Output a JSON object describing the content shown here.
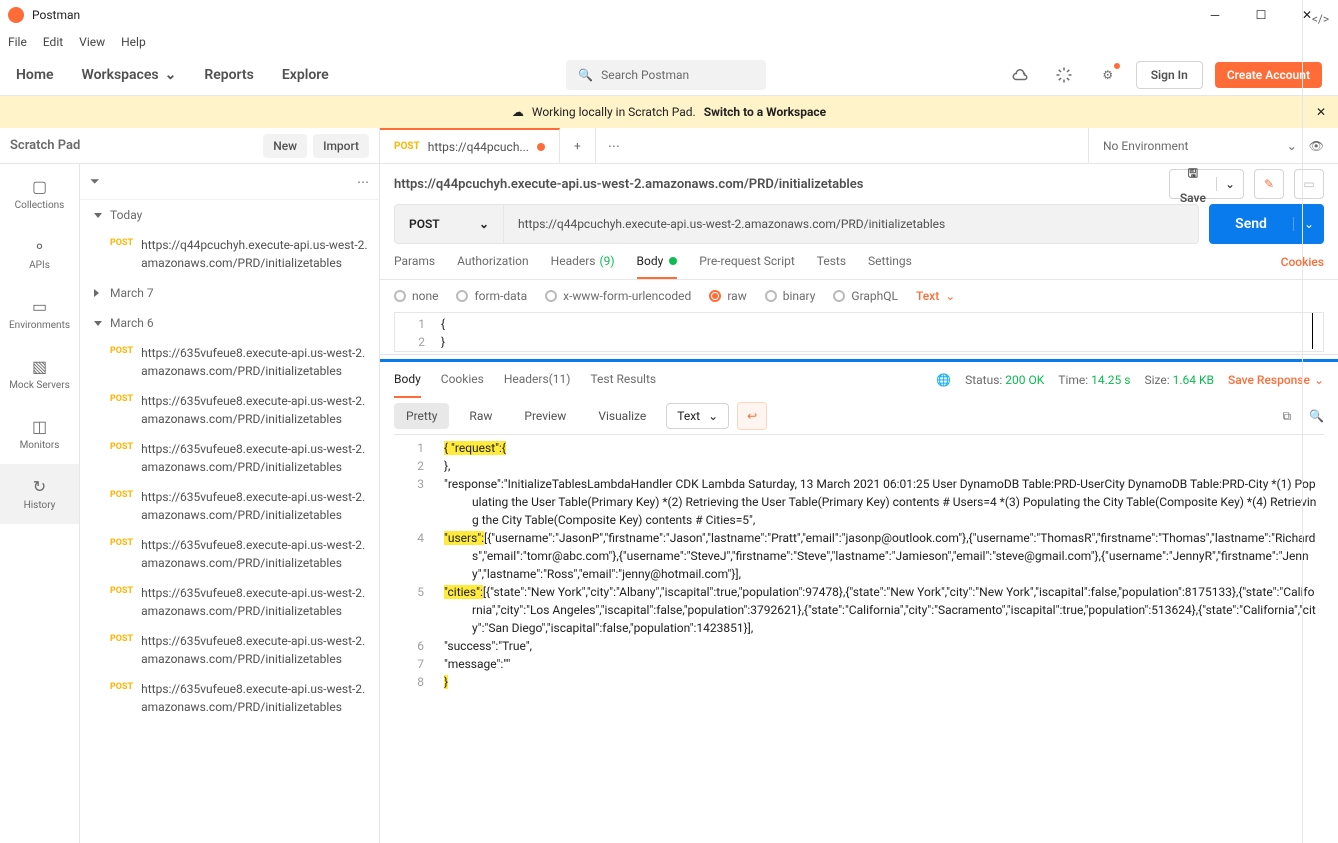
{
  "app": {
    "title": "Postman"
  },
  "menubar": [
    "File",
    "Edit",
    "View",
    "Help"
  ],
  "header": {
    "nav": [
      "Home",
      "Workspaces",
      "Reports",
      "Explore"
    ],
    "search_placeholder": "Search Postman",
    "signin": "Sign In",
    "create": "Create Account"
  },
  "banner": {
    "text": "Working locally in Scratch Pad.",
    "link": "Switch to a Workspace"
  },
  "sidebar": {
    "title": "Scratch Pad",
    "new": "New",
    "import": "Import",
    "iconbar": [
      {
        "label": "Collections"
      },
      {
        "label": "APIs"
      },
      {
        "label": "Environments"
      },
      {
        "label": "Mock Servers"
      },
      {
        "label": "Monitors"
      },
      {
        "label": "History"
      }
    ],
    "history": {
      "groups": [
        {
          "name": "Today",
          "items": [
            {
              "method": "POST",
              "url": "https://q44pcuchyh.execute-api.us-west-2.amazonaws.com/PRD/initializetables"
            }
          ]
        },
        {
          "name": "March 7",
          "collapsed": true,
          "items": []
        },
        {
          "name": "March 6",
          "items": [
            {
              "method": "POST",
              "url": "https://635vufeue8.execute-api.us-west-2.amazonaws.com/PRD/initializetables"
            },
            {
              "method": "POST",
              "url": "https://635vufeue8.execute-api.us-west-2.amazonaws.com/PRD/initializetables"
            },
            {
              "method": "POST",
              "url": "https://635vufeue8.execute-api.us-west-2.amazonaws.com/PRD/initializetables"
            },
            {
              "method": "POST",
              "url": "https://635vufeue8.execute-api.us-west-2.amazonaws.com/PRD/initializetables"
            },
            {
              "method": "POST",
              "url": "https://635vufeue8.execute-api.us-west-2.amazonaws.com/PRD/initializetables"
            },
            {
              "method": "POST",
              "url": "https://635vufeue8.execute-api.us-west-2.amazonaws.com/PRD/initializetables"
            },
            {
              "method": "POST",
              "url": "https://635vufeue8.execute-api.us-west-2.amazonaws.com/PRD/initializetables"
            },
            {
              "method": "POST",
              "url": "https://635vufeue8.execute-api.us-west-2.amazonaws.com/PRD/initializetables"
            }
          ]
        }
      ]
    }
  },
  "tab": {
    "method": "POST",
    "label": "https://q44pcuch..."
  },
  "env": "No Environment",
  "request": {
    "title": "https://q44pcuchyh.execute-api.us-west-2.amazonaws.com/PRD/initializetables",
    "save": "Save",
    "method": "POST",
    "url": "https://q44pcuchyh.execute-api.us-west-2.amazonaws.com/PRD/initializetables",
    "send": "Send",
    "tabs": {
      "params": "Params",
      "auth": "Authorization",
      "headers": "Headers",
      "headers_count": "(9)",
      "body": "Body",
      "prereq": "Pre-request Script",
      "tests": "Tests",
      "settings": "Settings",
      "cookies": "Cookies"
    },
    "bodytypes": [
      "none",
      "form-data",
      "x-www-form-urlencoded",
      "raw",
      "binary",
      "GraphQL"
    ],
    "raw_type": "Text",
    "body_lines": [
      "{",
      "}"
    ]
  },
  "response": {
    "tabs": {
      "body": "Body",
      "cookies": "Cookies",
      "headers": "Headers",
      "headers_count": "(11)",
      "tests": "Test Results"
    },
    "status_label": "Status:",
    "status_value": "200 OK",
    "time_label": "Time:",
    "time_value": "14.25 s",
    "size_label": "Size:",
    "size_value": "1.64 KB",
    "save": "Save Response",
    "view_opts": [
      "Pretty",
      "Raw",
      "Preview",
      "Visualize"
    ],
    "view_type": "Text",
    "lines": [
      {
        "n": 1,
        "segments": [
          {
            "t": "{ \"request\":{",
            "hl": true
          }
        ]
      },
      {
        "n": 2,
        "segments": [
          {
            "t": "},"
          }
        ]
      },
      {
        "n": 3,
        "segments": [
          {
            "t": "\"response\":\"InitializeTablesLambdaHandler CDK Lambda Saturday, 13 March 2021 06:01:25 User DynamoDB Table:PRD-UserCity DynamoDB Table:PRD-City *(1) Populating the User Table(Primary Key) *(2) Retrieving the User Table(Primary Key) contents # Users=4 *(3) Populating the City Table(Composite Key) *(4) Retrieving the City Table(Composite Key) contents # Cities=5\","
          }
        ]
      },
      {
        "n": 4,
        "segments": [
          {
            "t": "\"users\":",
            "hl": true
          },
          {
            "t": "[{\"username\":\"JasonP\",\"firstname\":\"Jason\",\"lastname\":\"Pratt\",\"email\":\"jasonp@outlook.com\"},{\"username\":\"ThomasR\",\"firstname\":\"Thomas\",\"lastname\":\"Richards\",\"email\":\"tomr@abc.com\"},{\"username\":\"SteveJ\",\"firstname\":\"Steve\",\"lastname\":\"Jamieson\",\"email\":\"steve@gmail.com\"},{\"username\":\"JennyR\",\"firstname\":\"Jenny\",\"lastname\":\"Ross\",\"email\":\"jenny@hotmail.com\"}],"
          }
        ]
      },
      {
        "n": 5,
        "segments": [
          {
            "t": "\"cities\":",
            "hl": true
          },
          {
            "t": "[{\"state\":\"New York\",\"city\":\"Albany\",\"iscapital\":true,\"population\":97478},{\"state\":\"New York\",\"city\":\"New York\",\"iscapital\":false,\"population\":8175133},{\"state\":\"California\",\"city\":\"Los Angeles\",\"iscapital\":false,\"population\":3792621},{\"state\":\"California\",\"city\":\"Sacramento\",\"iscapital\":true,\"population\":513624},{\"state\":\"California\",\"city\":\"San Diego\",\"iscapital\":false,\"population\":1423851}],"
          }
        ]
      },
      {
        "n": 6,
        "segments": [
          {
            "t": "\"success\":\"True\","
          }
        ]
      },
      {
        "n": 7,
        "segments": [
          {
            "t": "\"message\":\"\""
          }
        ]
      },
      {
        "n": 8,
        "segments": [
          {
            "t": "}",
            "hl": true
          }
        ]
      }
    ]
  }
}
